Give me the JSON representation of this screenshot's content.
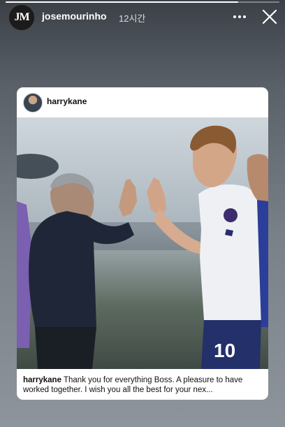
{
  "story": {
    "owner_username": "josemourinho",
    "time_ago": "12시간",
    "progress_fraction": 0.85,
    "owner_avatar_text": "JM"
  },
  "icons": {
    "more": "more-horizontal-icon",
    "close": "close-icon"
  },
  "shared_post": {
    "author": "harrykane",
    "caption_author": "harrykane",
    "caption_text": "Thank you for everything Boss. A pleasure to have worked together. I wish you all the best for your nex...",
    "jersey_number": "10"
  },
  "colors": {
    "card_background": "#ffffff",
    "story_background_top": "#3b4047",
    "story_background_bottom": "#8e949b"
  }
}
